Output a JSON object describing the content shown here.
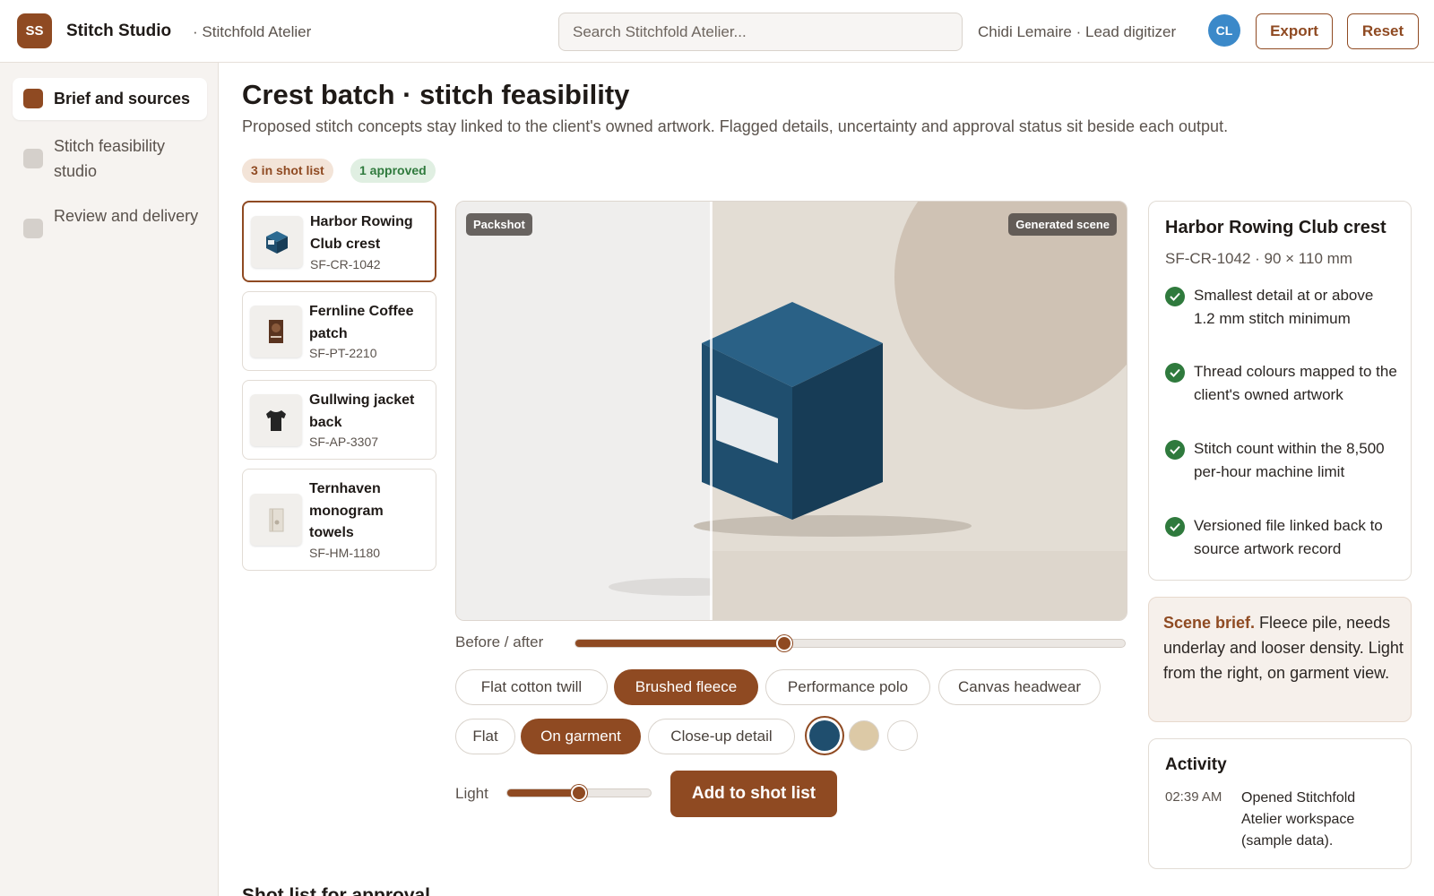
{
  "header": {
    "logo_initials": "SS",
    "app_name": "Stitch Studio",
    "workspace": "· Stitchfold Atelier",
    "search_placeholder": "Search Stitchfold Atelier...",
    "user_line": "Chidi Lemaire · Lead digitizer",
    "avatar_initials": "CL",
    "export_label": "Export",
    "reset_label": "Reset"
  },
  "sidebar": {
    "items": [
      {
        "label": "Brief and sources",
        "active": true
      },
      {
        "label": "Stitch feasibility studio",
        "active": false
      },
      {
        "label": "Review and delivery",
        "active": false
      }
    ]
  },
  "main": {
    "title": "Crest batch · stitch feasibility",
    "subtitle": "Proposed stitch concepts stay linked to the client's owned artwork. Flagged details, uncertainty and approval status sit beside each output.",
    "badges": {
      "shot_list": "3 in shot list",
      "approved": "1 approved"
    },
    "products": [
      {
        "name": "Harbor Rowing Club crest",
        "sku": "SF-CR-1042",
        "icon": "cube-icon",
        "selected": true
      },
      {
        "name": "Fernline Coffee patch",
        "sku": "SF-PT-2210",
        "icon": "coffee-bag-icon",
        "selected": false
      },
      {
        "name": "Gullwing jacket back",
        "sku": "SF-AP-3307",
        "icon": "tshirt-icon",
        "selected": false
      },
      {
        "name": "Ternhaven monogram towels",
        "sku": "SF-HM-1180",
        "icon": "towel-icon",
        "selected": false
      }
    ],
    "preview": {
      "left_tag": "Packshot",
      "right_tag": "Generated scene",
      "before_after_label": "Before / after",
      "before_after_value": 0.38
    },
    "fabrics": [
      {
        "label": "Flat cotton twill",
        "active": false
      },
      {
        "label": "Brushed fleece",
        "active": true
      },
      {
        "label": "Performance polo",
        "active": false
      },
      {
        "label": "Canvas headwear",
        "active": false
      }
    ],
    "views": [
      {
        "label": "Flat",
        "active": false
      },
      {
        "label": "On garment",
        "active": true
      },
      {
        "label": "Close-up detail",
        "active": false
      }
    ],
    "swatches": [
      {
        "color": "#1f4e6e",
        "selected": true
      },
      {
        "color": "#dcc9a6",
        "selected": false
      },
      {
        "color": "#ffffff",
        "selected": false
      }
    ],
    "light_label": "Light",
    "light_value": 0.5,
    "add_button": "Add to shot list",
    "next_section_peek": "Shot list for approval"
  },
  "detail": {
    "title": "Harbor Rowing Club crest",
    "meta": "SF-CR-1042 · 90 × 110 mm",
    "checks": [
      "Smallest detail at or above 1.2 mm stitch minimum",
      "Thread colours mapped to the client's owned artwork",
      "Stitch count within the 8,500 per-hour machine limit",
      "Versioned file linked back to source artwork record"
    ]
  },
  "brief": {
    "label": "Scene brief.",
    "text": " Fleece pile, needs underlay and looser density. Light from the right, on garment view."
  },
  "activity": {
    "title": "Activity",
    "entries": [
      {
        "time": "02:39 AM",
        "text": "Opened Stitchfold Atelier workspace (sample data)."
      }
    ]
  },
  "colors": {
    "accent": "#8f4a22",
    "success": "#2f7a3d",
    "avatar": "#3b89c9"
  }
}
